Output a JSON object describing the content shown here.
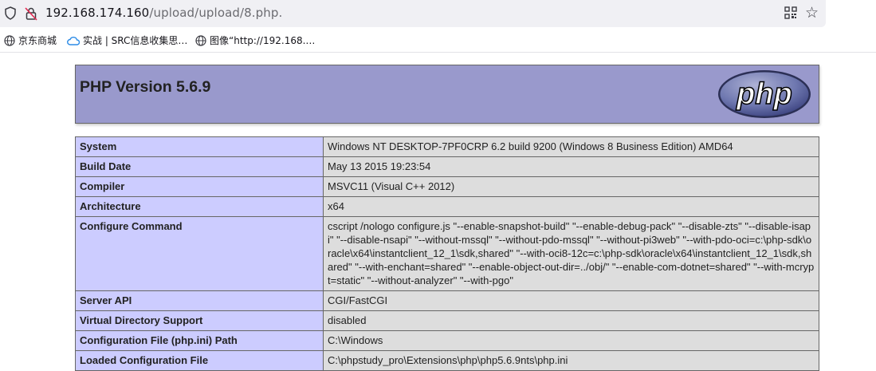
{
  "browser": {
    "url_host": "192.168.174.160",
    "url_path": "/upload/upload/8.php.",
    "bookmarks": [
      {
        "label": "京东商城",
        "icon": "globe-icon"
      },
      {
        "label": "实战 | SRC信息收集思…",
        "icon": "cloud-icon"
      },
      {
        "label": "图像“http://192.168.…",
        "icon": "globe-icon"
      }
    ]
  },
  "phpinfo": {
    "title": "PHP Version 5.6.9",
    "logo_text": "php",
    "rows": [
      {
        "key": "System",
        "value": "Windows NT DESKTOP-7PF0CRP 6.2 build 9200 (Windows 8 Business Edition) AMD64"
      },
      {
        "key": "Build Date",
        "value": "May 13 2015 19:23:54"
      },
      {
        "key": "Compiler",
        "value": "MSVC11 (Visual C++ 2012)"
      },
      {
        "key": "Architecture",
        "value": "x64"
      },
      {
        "key": "Configure Command",
        "value": "cscript /nologo configure.js \"--enable-snapshot-build\" \"--enable-debug-pack\" \"--disable-zts\" \"--disable-isapi\" \"--disable-nsapi\" \"--without-mssql\" \"--without-pdo-mssql\" \"--without-pi3web\" \"--with-pdo-oci=c:\\php-sdk\\oracle\\x64\\instantclient_12_1\\sdk,shared\" \"--with-oci8-12c=c:\\php-sdk\\oracle\\x64\\instantclient_12_1\\sdk,shared\" \"--with-enchant=shared\" \"--enable-object-out-dir=../obj/\" \"--enable-com-dotnet=shared\" \"--with-mcrypt=static\" \"--without-analyzer\" \"--with-pgo\""
      },
      {
        "key": "Server API",
        "value": "CGI/FastCGI"
      },
      {
        "key": "Virtual Directory Support",
        "value": "disabled"
      },
      {
        "key": "Configuration File (php.ini) Path",
        "value": "C:\\Windows"
      },
      {
        "key": "Loaded Configuration File",
        "value": "C:\\phpstudy_pro\\Extensions\\php\\php5.6.9nts\\php.ini"
      }
    ]
  },
  "colors": {
    "header_bg": "#9999cc",
    "key_bg": "#ccccff",
    "value_bg": "#dddddd"
  }
}
